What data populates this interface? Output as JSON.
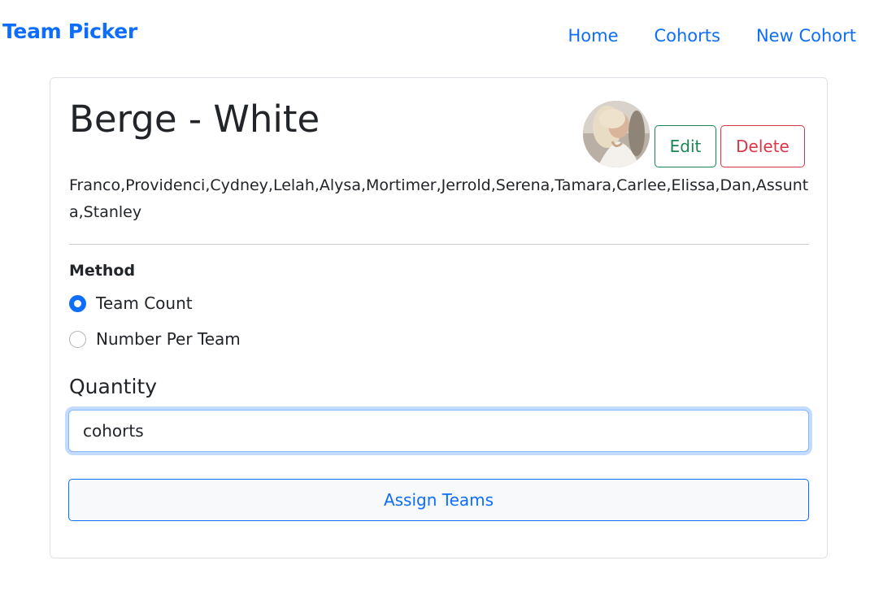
{
  "navbar": {
    "brand": "Team Picker",
    "links": [
      "Home",
      "Cohorts",
      "New Cohort"
    ]
  },
  "cohort": {
    "name": "Berge - White",
    "members": "Franco,Providenci,Cydney,Lelah,Alysa,Mortimer,Jerrold,Serena,Tamara,Carlee,Elissa,Dan,Assunta,Stanley",
    "edit_label": "Edit",
    "delete_label": "Delete"
  },
  "form": {
    "method_label": "Method",
    "options": [
      {
        "label": "Team Count",
        "checked": true
      },
      {
        "label": "Number Per Team",
        "checked": false
      }
    ],
    "quantity_label": "Quantity",
    "quantity_value": "cohorts",
    "submit_label": "Assign Teams"
  },
  "colors": {
    "primary": "#0d6efd",
    "success": "#198754",
    "danger": "#dc3545"
  }
}
